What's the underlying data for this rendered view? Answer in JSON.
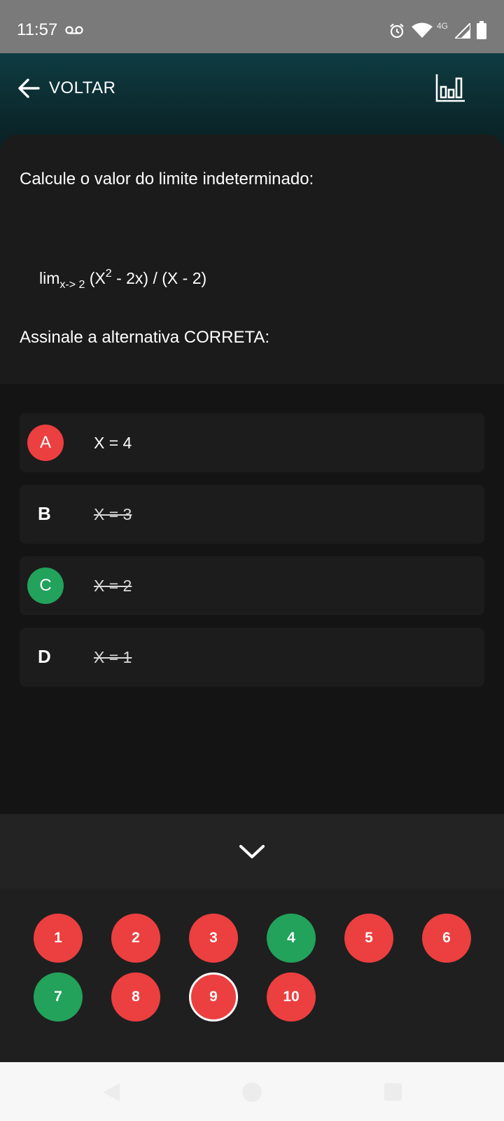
{
  "status_bar": {
    "time": "11:57",
    "network": "4G"
  },
  "header": {
    "back_label": "VOLTAR",
    "back_icon": "arrow-left-icon",
    "stats_icon": "bar-chart-icon"
  },
  "question": {
    "intro": "Calcule o valor do limite indeterminado:",
    "formula": {
      "lim": "lim",
      "subscript": "x-> 2",
      "part1": " (X",
      "exponent": "2",
      "part2": " - 2x) / (X - 2)"
    },
    "prompt": "Assinale a alternativa CORRETA:"
  },
  "options": [
    {
      "letter": "A",
      "text": "X = 4",
      "state": "wrong-selected",
      "struck": false
    },
    {
      "letter": "B",
      "text": "X = 3",
      "state": "eliminated",
      "struck": true
    },
    {
      "letter": "C",
      "text": "X = 2",
      "state": "correct",
      "struck": true
    },
    {
      "letter": "D",
      "text": "X = 1",
      "state": "eliminated",
      "struck": true
    }
  ],
  "navigator": {
    "collapse_icon": "chevron-down-icon",
    "questions": [
      {
        "number": "1",
        "status": "wrong",
        "current": false
      },
      {
        "number": "2",
        "status": "wrong",
        "current": false
      },
      {
        "number": "3",
        "status": "wrong",
        "current": false
      },
      {
        "number": "4",
        "status": "correct",
        "current": false
      },
      {
        "number": "5",
        "status": "wrong",
        "current": false
      },
      {
        "number": "6",
        "status": "wrong",
        "current": false
      },
      {
        "number": "7",
        "status": "correct",
        "current": false
      },
      {
        "number": "8",
        "status": "wrong",
        "current": false
      },
      {
        "number": "9",
        "status": "wrong",
        "current": true
      },
      {
        "number": "10",
        "status": "wrong",
        "current": false
      }
    ]
  },
  "colors": {
    "wrong": "#ec3f3f",
    "correct": "#22a25a",
    "accent_header": "#0e3c42"
  }
}
